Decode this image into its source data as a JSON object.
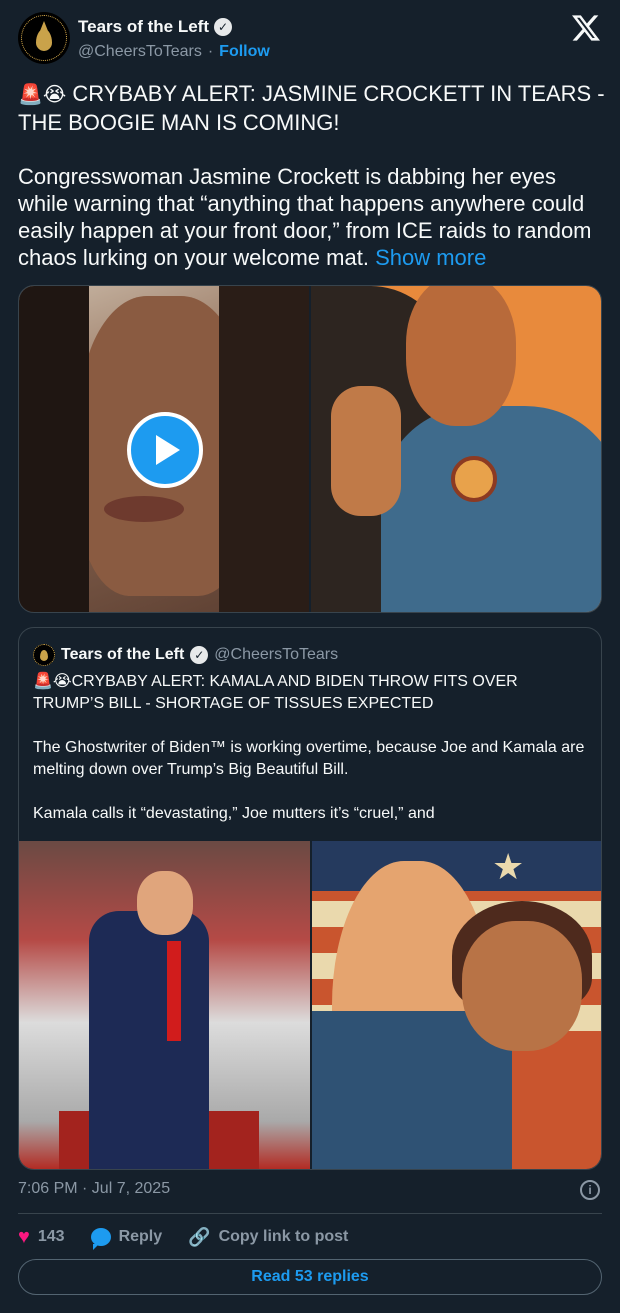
{
  "author": {
    "name": "Tears of the Left",
    "handle": "@CheersToTears",
    "separator": "·",
    "follow_label": "Follow"
  },
  "tweet": {
    "headline_emoji": "🚨😭",
    "headline": "CRYBABY ALERT: JASMINE CROCKETT IN TEARS - THE BOOGIE MAN IS COMING!",
    "body": "Congresswoman Jasmine Crockett is dabbing her eyes while warning that “anything that happens anywhere could easily happen at your front door,” from ICE raids to random chaos lurking on your welcome mat.",
    "show_more": "Show more"
  },
  "quoted": {
    "name": "Tears of the Left",
    "handle": "@CheersToTears",
    "headline_emoji": "🚨😭",
    "headline": "CRYBABY ALERT: KAMALA AND BIDEN THROW FITS OVER TRUMP’S BILL - SHORTAGE OF TISSUES EXPECTED",
    "para1": "The Ghostwriter of Biden™ is working overtime, because Joe and Kamala are melting down over Trump’s Big Beautiful Bill.",
    "para2": "Kamala calls it “devastating,” Joe mutters it’s “cruel,” and"
  },
  "footer": {
    "timestamp": "7:06 PM · Jul 7, 2025",
    "likes": "143",
    "reply_label": "Reply",
    "copy_link_label": "Copy link to post",
    "read_replies_label": "Read 53 replies"
  },
  "icons": {
    "brand": "x-logo-icon",
    "verified": "verified-badge-icon",
    "like": "heart-icon",
    "reply": "reply-bubble-icon",
    "copy": "link-icon",
    "info": "info-icon",
    "play": "play-icon"
  },
  "colors": {
    "background": "#15202b",
    "accent": "#1d9bf0",
    "like": "#f91880",
    "muted": "#8b98a5",
    "border": "#38444d"
  }
}
